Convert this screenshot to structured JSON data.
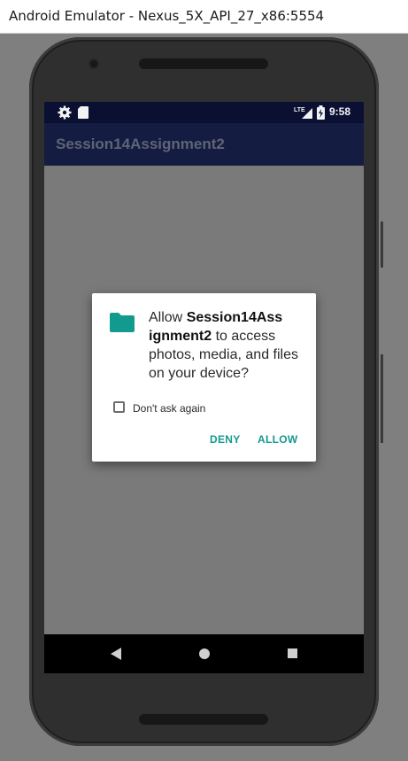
{
  "window": {
    "title": "Android Emulator - Nexus_5X_API_27_x86:5554"
  },
  "status_bar": {
    "time": "9:58",
    "network_label": "LTE"
  },
  "app_bar": {
    "title": "Session14Assignment2"
  },
  "dialog": {
    "message_prefix": "Allow ",
    "app_name": "Session14Ass ignment2",
    "message_suffix": " to access photos, media, and files on your device?",
    "checkbox_label": "Don't ask again",
    "deny_label": "DENY",
    "allow_label": "ALLOW"
  },
  "colors": {
    "accent": "#139a8e",
    "app_bar": "#141c42",
    "status_bar": "#0b1033",
    "scrim": "#7a7a7a"
  }
}
